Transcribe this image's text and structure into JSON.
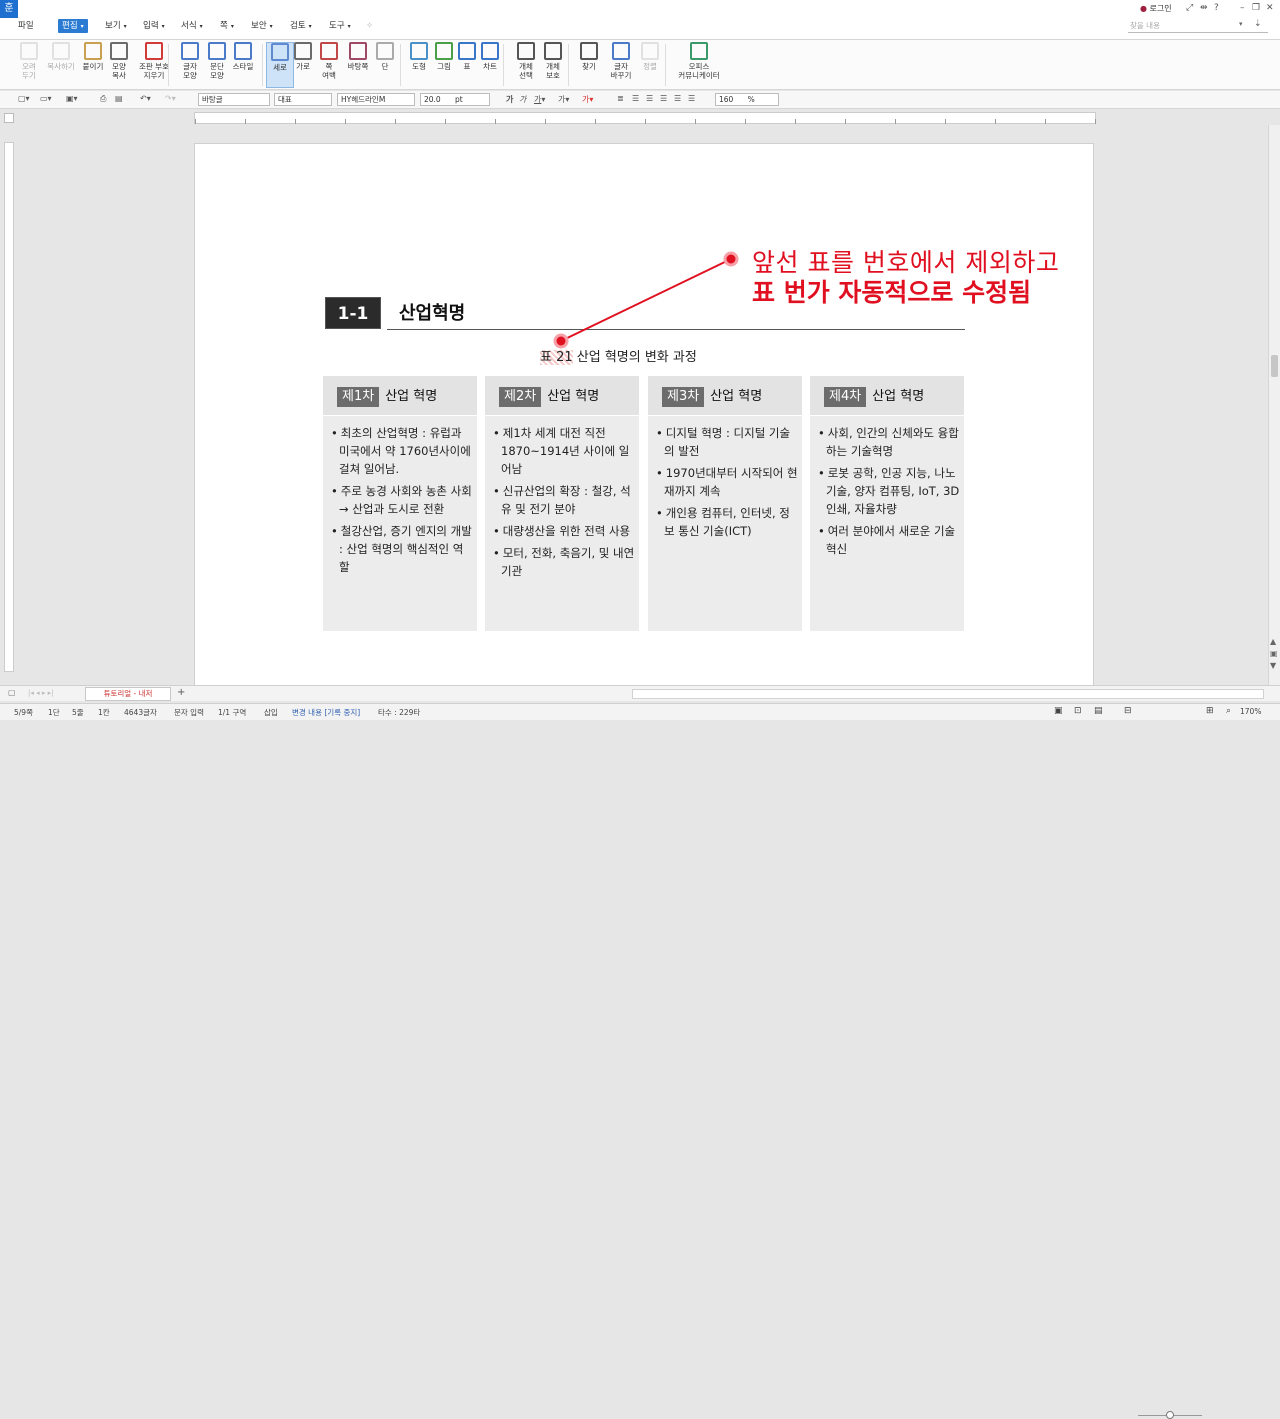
{
  "menubar": {
    "logo": "훈",
    "file": "파일",
    "items": [
      "편집",
      "보기",
      "입력",
      "서식",
      "쪽",
      "보안",
      "검토",
      "도구"
    ],
    "search_placeholder": "찾을 내용",
    "login": "로그인"
  },
  "ribbon": {
    "buttons": [
      {
        "label": "오려\n두기",
        "icon": "scissors-icon"
      },
      {
        "label": "복사하기",
        "icon": "copy-icon"
      },
      {
        "label": "붙이기",
        "icon": "paste-icon"
      },
      {
        "label": "모양\n복사",
        "icon": "format-painter-icon"
      },
      {
        "label": "조판 부호\n지우기",
        "icon": "clear-codes-icon"
      },
      {
        "label": "글자\n모양",
        "icon": "char-shape-icon"
      },
      {
        "label": "문단\n모양",
        "icon": "para-shape-icon"
      },
      {
        "label": "스타일",
        "icon": "style-icon"
      },
      {
        "label": "세로",
        "icon": "portrait-icon"
      },
      {
        "label": "가로",
        "icon": "landscape-icon"
      },
      {
        "label": "쪽\n여백",
        "icon": "margin-icon"
      },
      {
        "label": "바탕쪽",
        "icon": "master-page-icon"
      },
      {
        "label": "단",
        "icon": "columns-icon"
      },
      {
        "label": "도형",
        "icon": "shape-icon"
      },
      {
        "label": "그림",
        "icon": "picture-icon"
      },
      {
        "label": "표",
        "icon": "table-icon"
      },
      {
        "label": "차트",
        "icon": "chart-icon"
      },
      {
        "label": "개체\n선택",
        "icon": "select-object-icon"
      },
      {
        "label": "개체\n보호",
        "icon": "protect-object-icon"
      },
      {
        "label": "찾기",
        "icon": "find-icon"
      },
      {
        "label": "글자\n바꾸기",
        "icon": "replace-icon"
      },
      {
        "label": "정렬",
        "icon": "sort-icon"
      },
      {
        "label": "오피스\n커뮤니케이터",
        "icon": "communicator-icon"
      }
    ]
  },
  "format": {
    "style": "바탕글",
    "lang": "대표",
    "font": "HY헤드라인M",
    "size": "20.0",
    "unit": "pt",
    "line_spacing": "160",
    "percent": "%"
  },
  "document": {
    "heading_number": "1-1",
    "heading_title": "산업혁명",
    "caption_num": "표 21",
    "caption_text": " 산업 혁명의 변화 과정",
    "columns": [
      {
        "badge": "제1차",
        "title": "산업 혁명",
        "items": [
          "최초의 산업혁명 : 유럽과 미국에서 약 1760년사이에 걸쳐 일어남.",
          "주로 농경 사회와 농촌 사회 → 산업과 도시로 전환",
          "철강산업, 증기 엔지의 개발 : 산업 혁명의 핵심적인 역할"
        ]
      },
      {
        "badge": "제2차",
        "title": "산업 혁명",
        "items": [
          "제1차 세계 대전 직전 1870~1914년 사이에 일어남",
          "신규산업의 확장 : 철강, 석유 및 전기 분야",
          "대량생산을 위한 전력 사용",
          "모터, 전화, 축음기, 및 내연기관"
        ]
      },
      {
        "badge": "제3차",
        "title": "산업 혁명",
        "items": [
          "디지털 혁명 : 디지털 기술의 발전",
          "1970년대부터 시작되어 현재까지 계속",
          "개인용 컴퓨터, 인터넷, 정보 통신 기술(ICT)"
        ]
      },
      {
        "badge": "제4차",
        "title": "산업 혁명",
        "items": [
          "사회, 인간의 신체와도 융합하는 기술혁명",
          "로봇 공학, 인공 지능, 나노 기술, 양자 컴퓨팅, IoT, 3D 인쇄, 자율차량",
          "여러 분야에서 새로운 기술 혁신"
        ]
      }
    ]
  },
  "annotation": {
    "line1": "앞선 표를 번호에서 제외하고",
    "line2": "표 번가 자동적으로 수정됨",
    "color": "#e01020"
  },
  "tabs": {
    "doc_tab": "튜토리얼 - 내저",
    "add": "+"
  },
  "status": {
    "page": "5/9쪽",
    "col": "1단",
    "line": "5줄",
    "pos": "1칸",
    "chars": "4643글자",
    "mode": "문자 입력",
    "section": "1/1 구역",
    "insert": "삽입",
    "track": "변경 내용 [기록 중지]",
    "typing": "타수 : 229타",
    "zoom": "170%"
  }
}
